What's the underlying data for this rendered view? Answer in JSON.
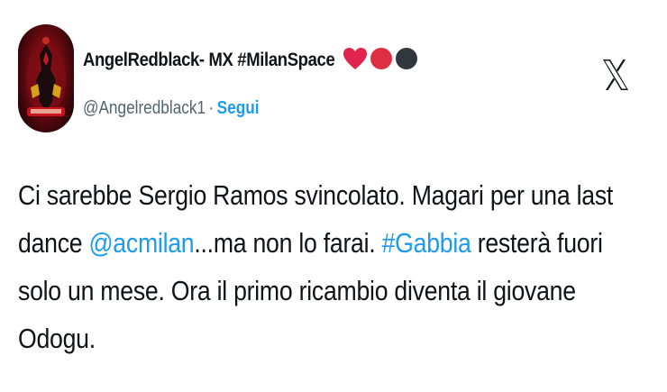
{
  "tweet": {
    "author": {
      "display_name": "AngelRedblack- MX #MilanSpace",
      "handle": "@Angelredblack1",
      "separator": "·",
      "follow_label": "Segui",
      "name_emojis": [
        "red-heart",
        "red-circle",
        "black-circle"
      ]
    },
    "platform_icon": "x-logo-icon",
    "text_lines": [
      [
        {
          "t": "Ci sarebbe Sergio Ramos svincolato. Magari per una last"
        }
      ],
      [
        {
          "t": "dance "
        },
        {
          "t": "@acmilan",
          "link": true
        },
        {
          "t": "...ma non lo farai. "
        },
        {
          "t": "#Gabbia",
          "link": true
        },
        {
          "t": " resterà fuori"
        }
      ],
      [
        {
          "t": "solo un mese. Ora il primo ricambio diventa il giovane"
        }
      ],
      [
        {
          "t": "Odogu."
        }
      ]
    ]
  },
  "colors": {
    "text": "#0f1419",
    "secondary": "#536471",
    "link": "#1d9bf0",
    "heart": "#e0244d",
    "circle_red": "#dd2e44",
    "circle_black": "#31373d"
  }
}
